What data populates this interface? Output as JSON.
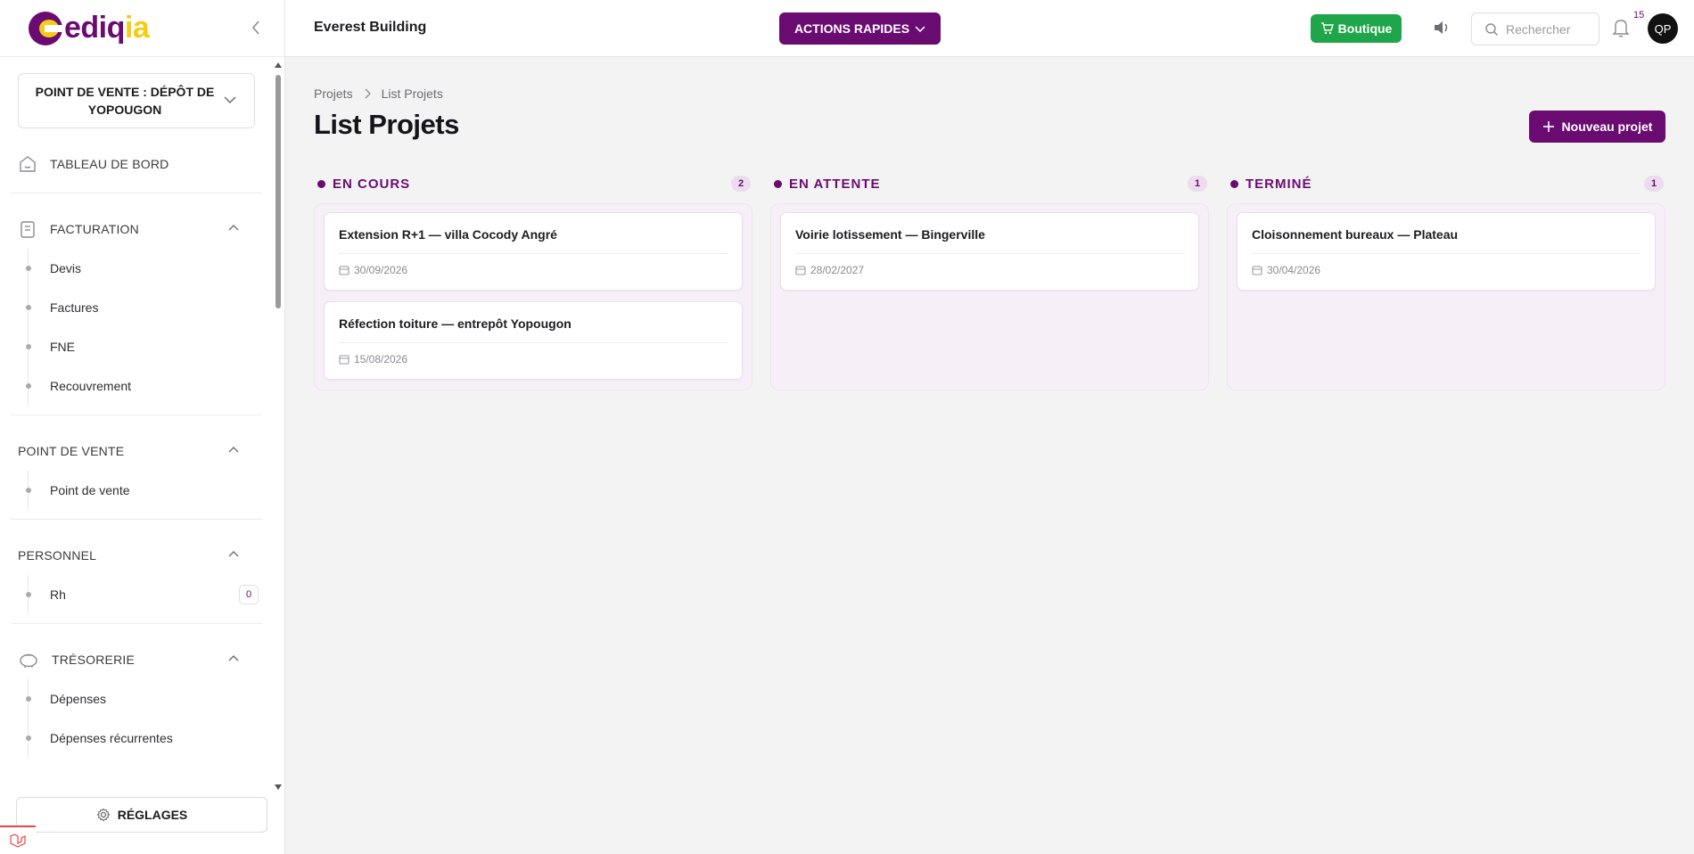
{
  "brand": {
    "logo_main": "ediq",
    "logo_accent": "ia"
  },
  "header": {
    "company": "Everest Building",
    "quick_actions": "ACTIONS RAPIDES",
    "shop": "Boutique",
    "search_placeholder": "Rechercher",
    "notifications_count": "15",
    "avatar_initials": "QP"
  },
  "sidebar": {
    "point_of_sale_select": "POINT DE VENTE : DÉPÔT DE YOPOUGON",
    "dashboard": "TABLEAU DE BORD",
    "sections": [
      {
        "title": "FACTURATION",
        "items": [
          "Devis",
          "Factures",
          "FNE",
          "Recouvrement"
        ]
      },
      {
        "title": "POINT DE VENTE",
        "items": [
          "Point de vente"
        ]
      },
      {
        "title": "PERSONNEL",
        "items": [
          "Rh"
        ],
        "badge": "0"
      },
      {
        "title": "TRÉSORERIE",
        "items": [
          "Dépenses",
          "Dépenses récurrentes"
        ]
      }
    ],
    "settings": "RÉGLAGES"
  },
  "main": {
    "breadcrumb": [
      "Projets",
      "List Projets"
    ],
    "title": "List Projets",
    "new_project": "Nouveau projet",
    "columns": [
      {
        "title": "EN COURS",
        "count": "2",
        "cards": [
          {
            "title": "Extension R+1 — villa Cocody Angré",
            "date": "30/09/2026"
          },
          {
            "title": "Réfection toiture — entrepôt Yopougon",
            "date": "15/08/2026"
          }
        ]
      },
      {
        "title": "EN ATTENTE",
        "count": "1",
        "cards": [
          {
            "title": "Voirie lotissement — Bingerville",
            "date": "28/02/2027"
          }
        ]
      },
      {
        "title": "TERMINÉ",
        "count": "1",
        "cards": [
          {
            "title": "Cloisonnement bureaux — Plateau",
            "date": "30/04/2026"
          }
        ]
      }
    ]
  },
  "colors": {
    "brand_purple": "#6a0b72",
    "brand_yellow": "#f4cc12",
    "shop_green": "#1fa64a"
  }
}
